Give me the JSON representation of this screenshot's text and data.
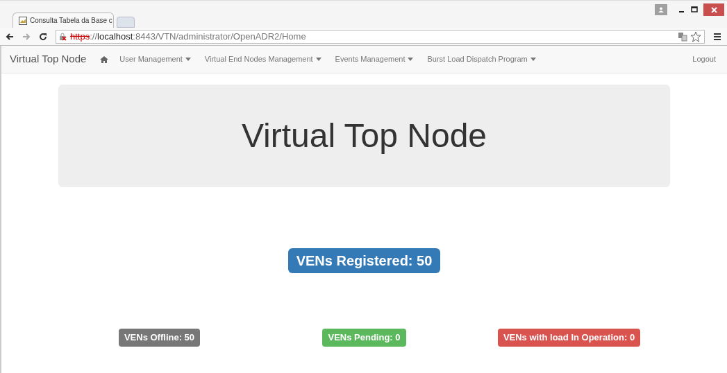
{
  "browser": {
    "tab": {
      "title": "Consulta Tabela da Base c",
      "selected": true
    },
    "url": {
      "scheme": "https",
      "separator": "://",
      "host": "localhost",
      "path": ":8443/VTN/administrator/OpenADR2/Home"
    }
  },
  "navbar": {
    "brand": "Virtual Top Node",
    "menus": [
      {
        "label": "User Management"
      },
      {
        "label": "Virtual End Nodes Management"
      },
      {
        "label": "Events Management"
      },
      {
        "label": "Burst Load Dispatch Program"
      }
    ],
    "logout": "Logout"
  },
  "jumbotron": {
    "title": "Virtual Top Node"
  },
  "main_badge": {
    "text": "VENs Registered: 50",
    "kind": "primary"
  },
  "badges": [
    {
      "text": "VENs Offline: 50",
      "kind": "default"
    },
    {
      "text": "VENs Pending: 0",
      "kind": "success"
    },
    {
      "text": "VENs with load In Operation: 0",
      "kind": "danger"
    }
  ]
}
